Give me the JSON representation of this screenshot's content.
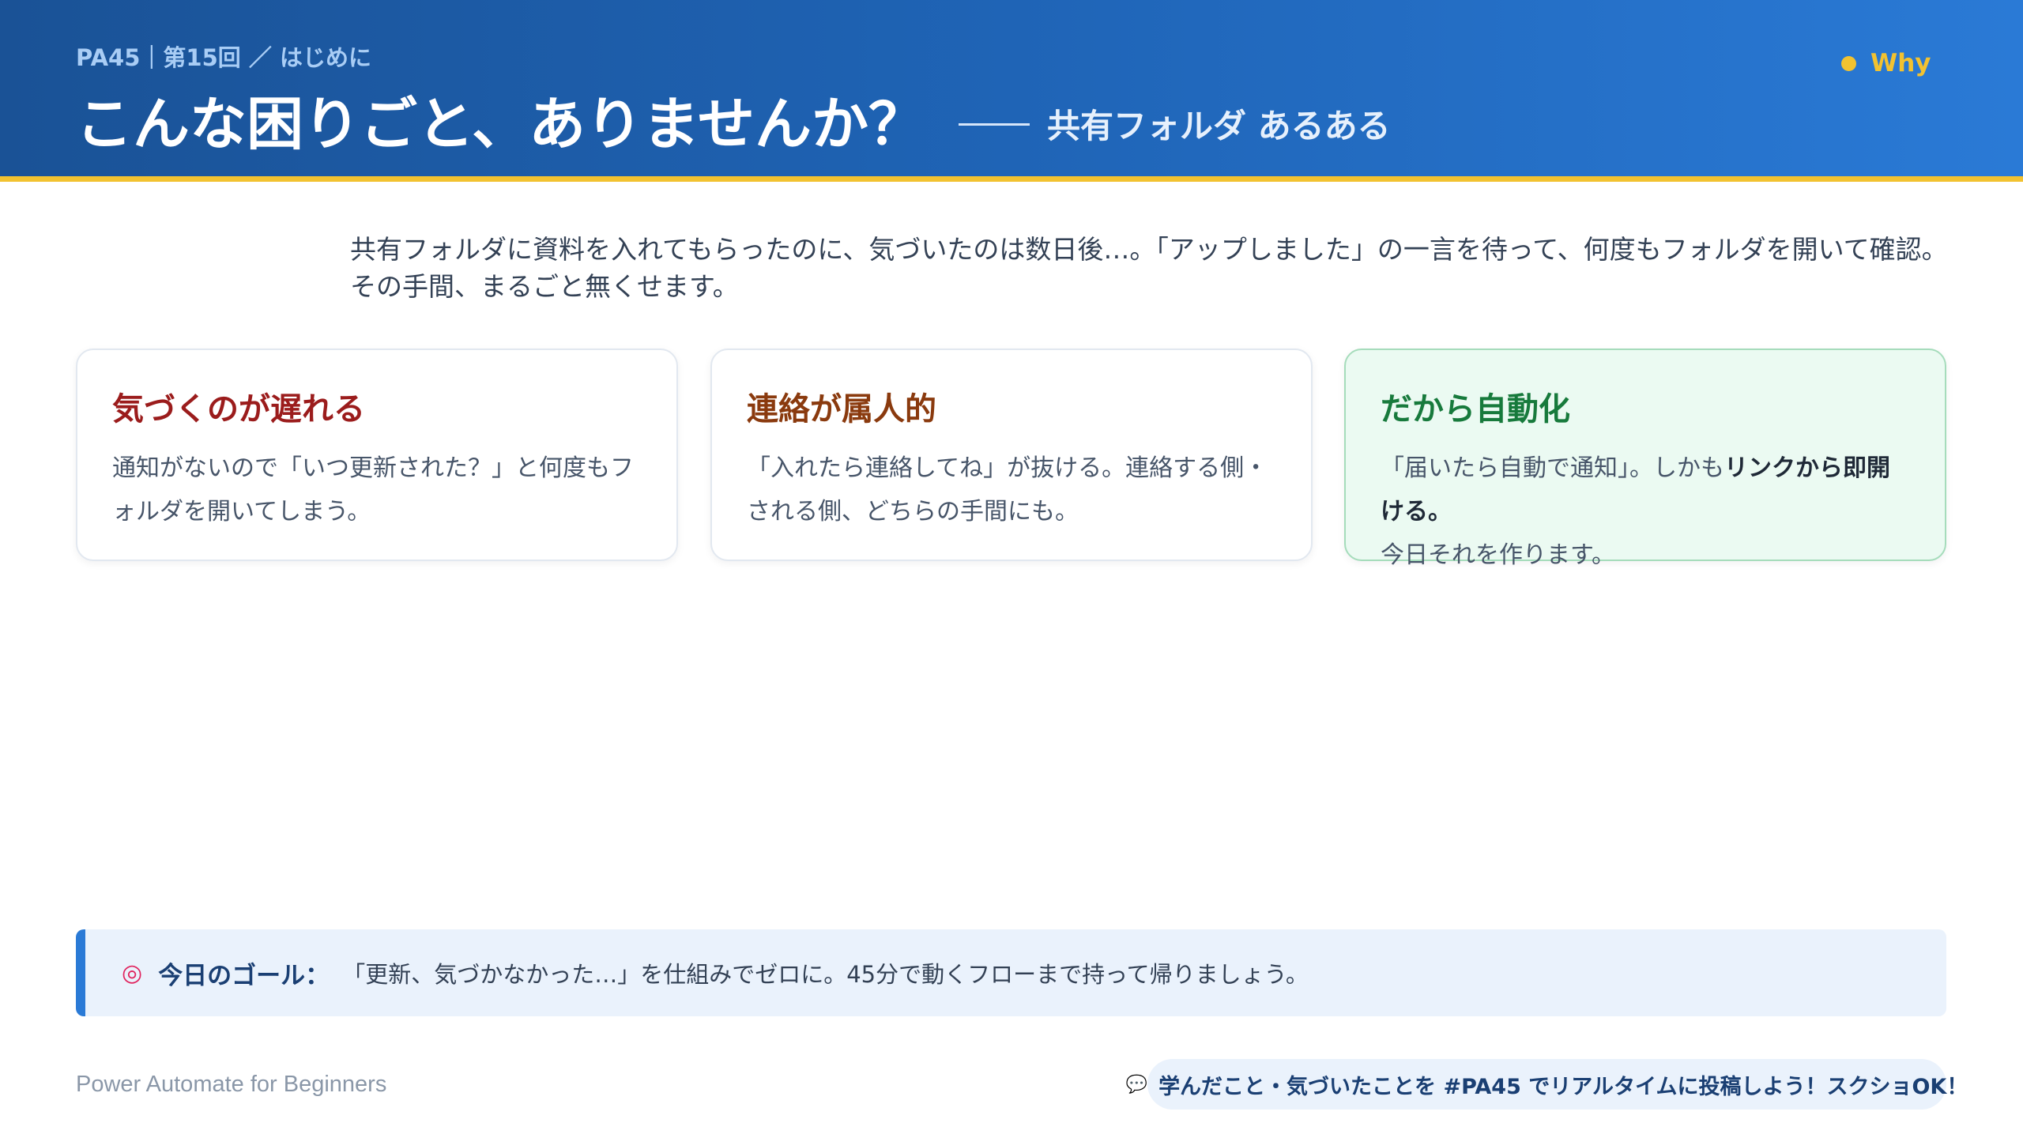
{
  "header": {
    "breadcrumb": "PA45｜第15回 ／ はじめに",
    "title": "こんな困りごと、ありませんか？",
    "subtitle": "共有フォルダ あるある",
    "badge": "Why",
    "colors": {
      "header_start": "#1a5296",
      "header_end": "#2a7ad6",
      "accent": "#f2c230"
    }
  },
  "intro": "共有フォルダに資料を入れてもらったのに、気づいたのは数日後…。「アップしました」の一言を待って、何度もフォルダを開いて確認。その手間、まるごと無くせます。",
  "cards": [
    {
      "title": "気づくのが遅れる",
      "title_color": "#9b1c1c",
      "body": "通知がないので「いつ更新された？」と何度もフォルダを開いてしまう。"
    },
    {
      "title": "連絡が属人的",
      "title_color": "#8a3a0e",
      "body": "「入れたら連絡してね」が抜ける。連絡する側・される側、どちらの手間にも。"
    },
    {
      "title": "だから自動化",
      "title_color": "#177a3c",
      "body_pre": "「届いたら自動で通知」。しかも",
      "body_strong": "リンクから即開ける。",
      "body_post": "今日それを作ります。"
    }
  ],
  "goal": {
    "icon": "target-icon",
    "label": "今日のゴール：",
    "text": "「更新、気づかなかった…」を仕組みでゼロに。45分で動くフローまで持って帰りましょう。"
  },
  "footer": {
    "left": "Power Automate for Beginners",
    "pill_icon": "speech-bubble-icon",
    "pill_text": "学んだこと・気づいたことを #PA45 でリアルタイムに投稿しよう！スクショOK！"
  }
}
